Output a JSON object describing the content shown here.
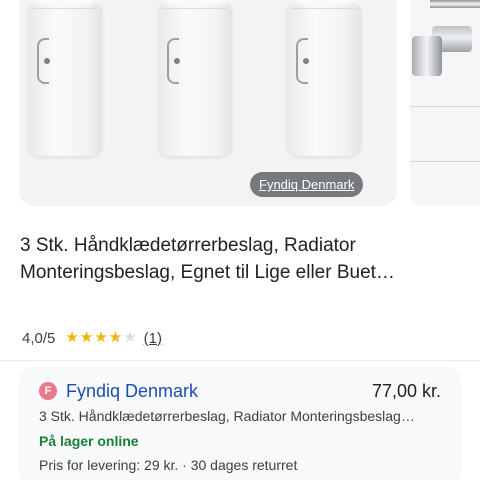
{
  "gallery": {
    "image_alt": "3 Stk. Håndklædetørrerbeslag product image",
    "store_chip": "Fyndiq Denmark"
  },
  "product": {
    "title": "3 Stk. Håndklædetørrerbeslag, Radiator Monteringsbeslag, Egnet til Lige eller Buet…",
    "rating": "4,0/5",
    "stars": {
      "filled": 4,
      "total": 5
    },
    "review_count": "(1)"
  },
  "offer": {
    "merchant_initial": "F",
    "merchant_name": "Fyndiq Denmark",
    "price": "77,00 kr.",
    "description": "3 Stk. Håndklædetørrerbeslag, Radiator Monteringsbeslag…",
    "stock": "På lager online",
    "delivery": "Pris for levering: 29 kr. · 30 dages returret"
  },
  "colors": {
    "accent_link": "#1a4fb0",
    "stock_green": "#188038",
    "star_gold": "#f4b400",
    "merchant_badge": "#ea7a8b"
  },
  "icons": [
    "star-icon",
    "merchant-favicon"
  ]
}
